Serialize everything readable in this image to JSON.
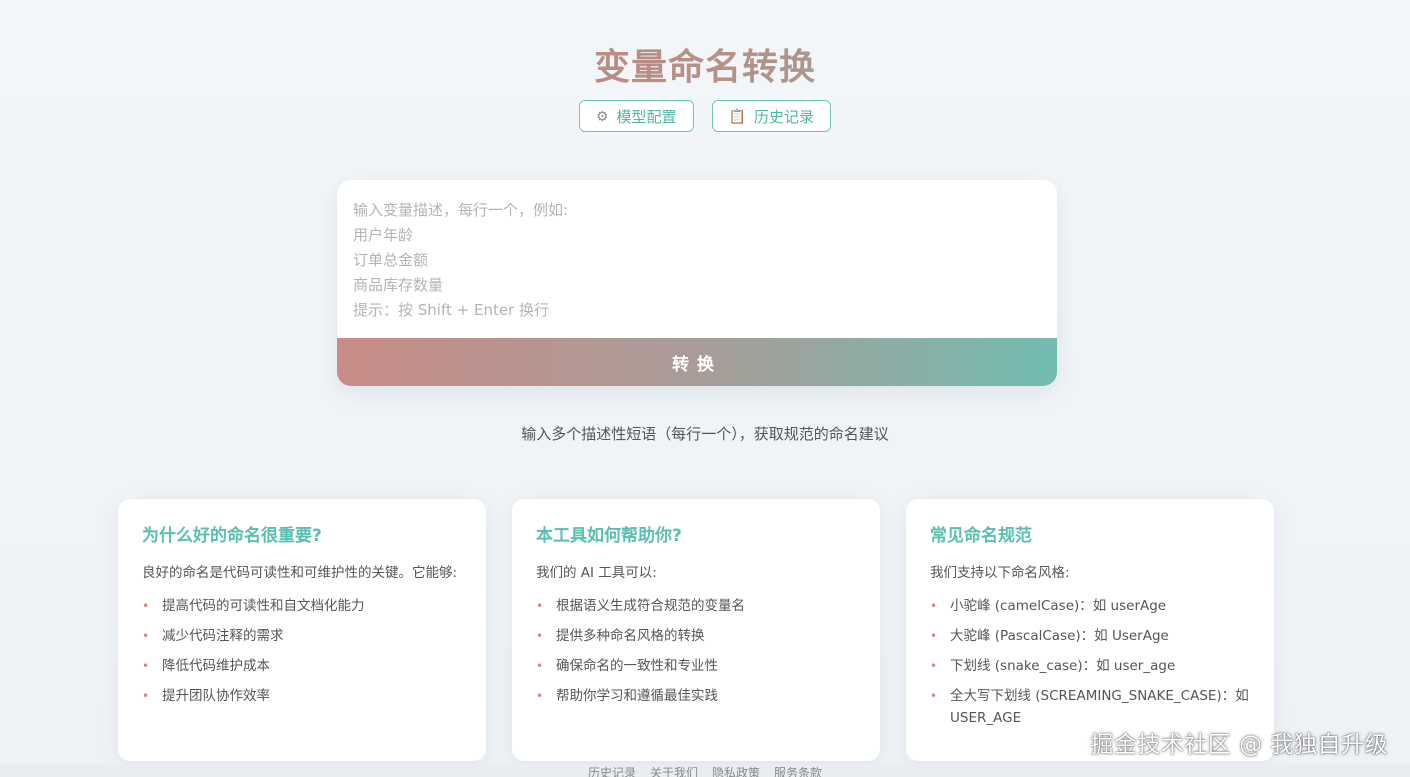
{
  "title": "变量命名转换",
  "header_buttons": {
    "model_config": "模型配置",
    "history": "历史记录"
  },
  "input": {
    "placeholder": "输入变量描述，每行一个，例如:\n用户年龄\n订单总金额\n商品库存数量\n提示：按 Shift + Enter 换行",
    "value": ""
  },
  "convert_button": "转换",
  "hint": "输入多个描述性短语（每行一个），获取规范的命名建议",
  "cards": [
    {
      "title": "为什么好的命名很重要?",
      "intro": "良好的命名是代码可读性和可维护性的关键。它能够:",
      "items": [
        "提高代码的可读性和自文档化能力",
        "减少代码注释的需求",
        "降低代码维护成本",
        "提升团队协作效率"
      ]
    },
    {
      "title": "本工具如何帮助你?",
      "intro": "我们的 AI 工具可以:",
      "items": [
        "根据语义生成符合规范的变量名",
        "提供多种命名风格的转换",
        "确保命名的一致性和专业性",
        "帮助你学习和遵循最佳实践"
      ]
    },
    {
      "title": "常见命名规范",
      "intro": "我们支持以下命名风格:",
      "items": [
        "小驼峰 (camelCase)：如 userAge",
        "大驼峰 (PascalCase)：如 UserAge",
        "下划线 (snake_case)：如 user_age",
        "全大写下划线 (SCREAMING_SNAKE_CASE)：如 USER_AGE"
      ]
    }
  ],
  "footer_links": [
    "历史记录",
    "关于我们",
    "隐私政策",
    "服务条款"
  ],
  "watermark": "掘金技术社区 @ 我独自升级",
  "colors": {
    "accent_teal": "#58bfb2",
    "accent_rose": "#d47a73"
  }
}
